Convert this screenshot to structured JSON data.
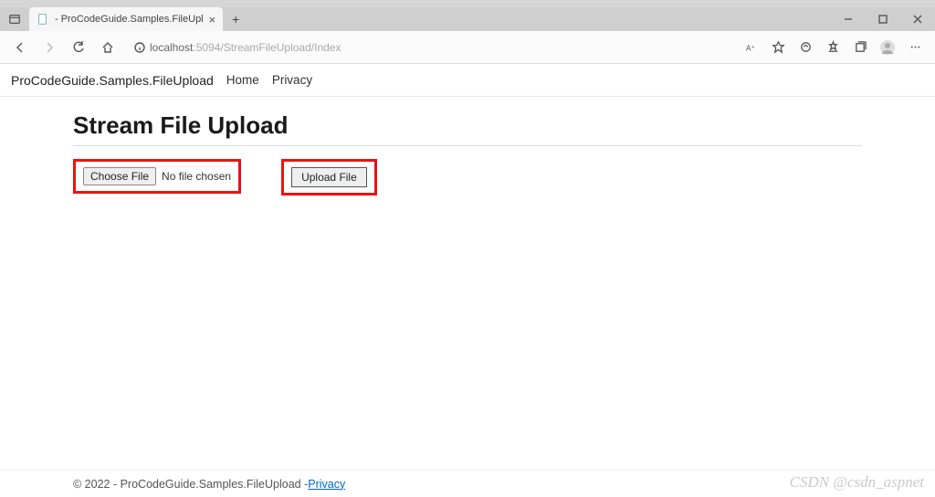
{
  "browser": {
    "tab_title": "- ProCodeGuide.Samples.FileUpl",
    "url_host": "localhost",
    "url_port_path": ":5094/StreamFileUpload/Index"
  },
  "nav": {
    "brand": "ProCodeGuide.Samples.FileUpload",
    "links": [
      "Home",
      "Privacy"
    ]
  },
  "page": {
    "heading": "Stream File Upload",
    "choose_label": "Choose File",
    "nofile_label": "No file chosen",
    "upload_label": "Upload File"
  },
  "footer": {
    "text": "© 2022 - ProCodeGuide.Samples.FileUpload - ",
    "privacy": "Privacy"
  },
  "watermark": "CSDN @csdn_aspnet"
}
